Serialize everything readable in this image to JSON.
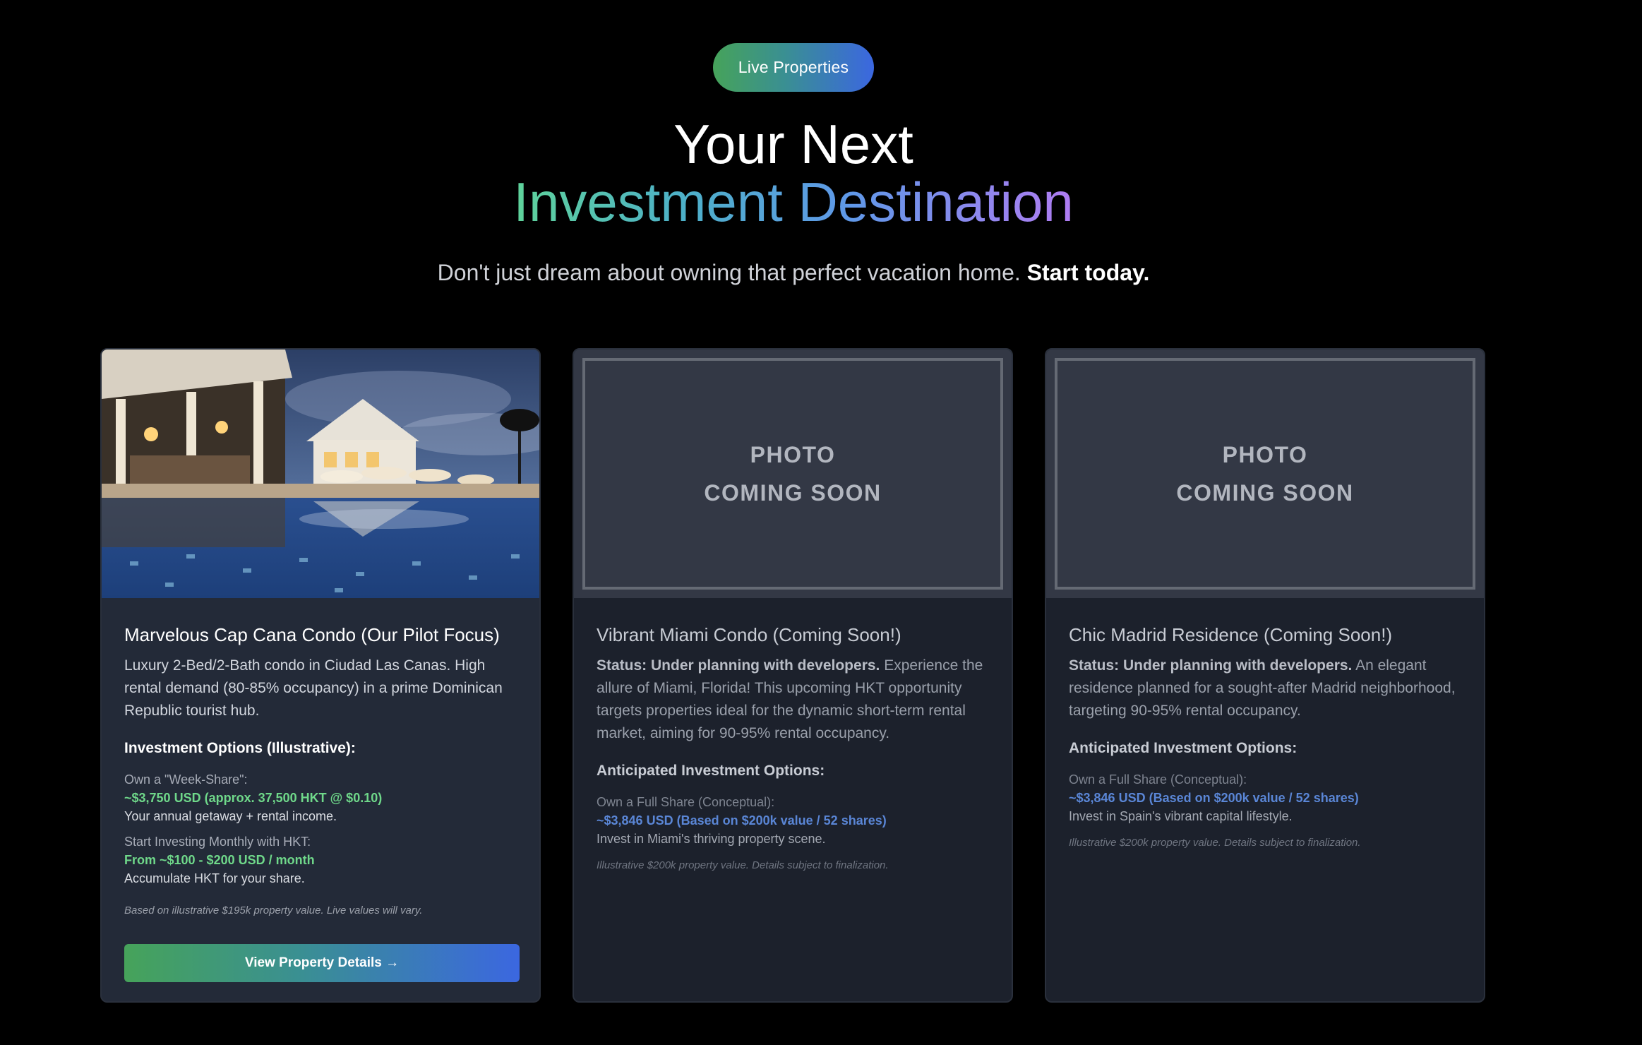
{
  "badge": {
    "label": "Live Properties"
  },
  "heading": {
    "line1": "Your Next",
    "line2": "Investment Destination"
  },
  "subtitle": {
    "text": "Don't just dream about owning that perfect vacation home. ",
    "emphasis": "Start today."
  },
  "colors": {
    "accent_green": "#46a35a",
    "accent_blue": "#3b67e0",
    "price_green": "#6fd88a",
    "price_blue": "#5a86d6"
  },
  "cards": [
    {
      "title": "Marvelous Cap Cana Condo (Our Pilot Focus)",
      "description": "Luxury 2-Bed/2-Bath condo in Ciudad Las Canas. High rental demand (80-85% occupancy) in a prime Dominican Republic tourist hub.",
      "options_title": "Investment Options (Illustrative):",
      "options": [
        {
          "label": "Own a \"Week-Share\":",
          "price": "~$3,750 USD (approx. 37,500 HKT @ $0.10)",
          "note": "Your annual getaway + rental income."
        },
        {
          "label": "Start Investing Monthly with HKT:",
          "price": "From ~$100 - $200 USD / month",
          "note": "Accumulate HKT for your share."
        }
      ],
      "disclaimer": "Based on illustrative $195k property value. Live values will vary.",
      "cta": "View Property Details →"
    },
    {
      "placeholder": [
        "PHOTO",
        "COMING SOON"
      ],
      "title": "Vibrant Miami Condo (Coming Soon!)",
      "status": "Status: Under planning with developers.",
      "description": " Experience the allure of Miami, Florida! This upcoming HKT opportunity targets properties ideal for the dynamic short-term rental market, aiming for 90-95% rental occupancy.",
      "options_title": "Anticipated Investment Options:",
      "options": [
        {
          "label": "Own a Full Share (Conceptual):",
          "price": "~$3,846 USD (Based on $200k value / 52 shares)",
          "note": "Invest in Miami's thriving property scene."
        }
      ],
      "disclaimer": "Illustrative $200k property value. Details subject to finalization."
    },
    {
      "placeholder": [
        "PHOTO",
        "COMING SOON"
      ],
      "title": "Chic Madrid Residence (Coming Soon!)",
      "status": "Status: Under planning with developers.",
      "description": " An elegant residence planned for a sought-after Madrid neighborhood, targeting 90-95% rental occupancy.",
      "options_title": "Anticipated Investment Options:",
      "options": [
        {
          "label": "Own a Full Share (Conceptual):",
          "price": "~$3,846 USD (Based on $200k value / 52 shares)",
          "note": "Invest in Spain's vibrant capital lifestyle."
        }
      ],
      "disclaimer": "Illustrative $200k property value. Details subject to finalization."
    }
  ]
}
